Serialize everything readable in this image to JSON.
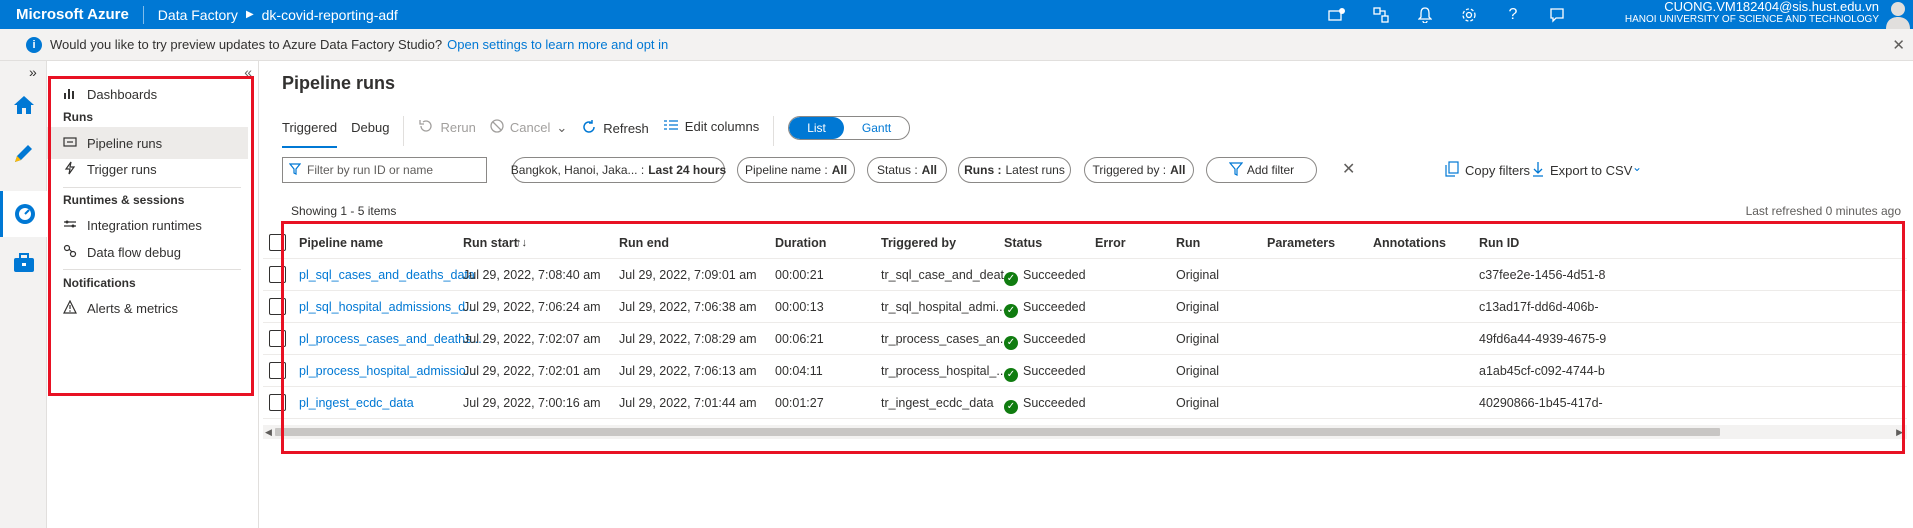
{
  "topbar": {
    "brand": "Microsoft Azure",
    "service": "Data Factory",
    "factory": "dk-covid-reporting-adf",
    "user_email": "CUONG.VM182404@sis.hust.edu.vn",
    "user_org": "HANOI UNIVERSITY OF SCIENCE AND TECHNOLOGY"
  },
  "banner": {
    "message": "Would you like to try preview updates to Azure Data Factory Studio?",
    "link": "Open settings to learn more and opt in"
  },
  "nav": {
    "dashboards": "Dashboards",
    "runs_header": "Runs",
    "pipeline_runs": "Pipeline runs",
    "trigger_runs": "Trigger runs",
    "runtimes_header": "Runtimes & sessions",
    "integration_runtimes": "Integration runtimes",
    "data_flow_debug": "Data flow debug",
    "notifications_header": "Notifications",
    "alerts_metrics": "Alerts & metrics"
  },
  "page": {
    "title": "Pipeline runs",
    "tab_triggered": "Triggered",
    "tab_debug": "Debug",
    "rerun": "Rerun",
    "cancel": "Cancel",
    "refresh": "Refresh",
    "edit_columns": "Edit columns",
    "view_list": "List",
    "view_gantt": "Gantt"
  },
  "filters": {
    "search_placeholder": "Filter by run ID or name",
    "timezone_label": "Bangkok, Hanoi, Jaka... :",
    "timezone_value": "Last 24 hours",
    "pipeline_label": "Pipeline name :",
    "pipeline_value": "All",
    "status_label": "Status :",
    "status_value": "All",
    "runs_label": "Runs :",
    "runs_value": "Latest runs",
    "triggered_label": "Triggered by :",
    "triggered_value": "All",
    "add_filter": "Add filter",
    "copy_filters": "Copy filters",
    "export_csv": "Export to CSV"
  },
  "grid": {
    "showing": "Showing 1 - 5 items",
    "last_refreshed": "Last refreshed 0 minutes ago",
    "columns": {
      "pipeline_name": "Pipeline name",
      "run_start": "Run start",
      "run_end": "Run end",
      "duration": "Duration",
      "triggered_by": "Triggered by",
      "status": "Status",
      "error": "Error",
      "run": "Run",
      "parameters": "Parameters",
      "annotations": "Annotations",
      "run_id": "Run ID"
    },
    "rows": [
      {
        "pipeline_name": "pl_sql_cases_and_deaths_data",
        "run_start": "Jul 29, 2022, 7:08:40 am",
        "run_end": "Jul 29, 2022, 7:09:01 am",
        "duration": "00:00:21",
        "triggered_by": "tr_sql_case_and_deat...",
        "status": "Succeeded",
        "run": "Original",
        "run_id": "c37fee2e-1456-4d51-8"
      },
      {
        "pipeline_name": "pl_sql_hospital_admissions_d...",
        "run_start": "Jul 29, 2022, 7:06:24 am",
        "run_end": "Jul 29, 2022, 7:06:38 am",
        "duration": "00:00:13",
        "triggered_by": "tr_sql_hospital_admi...",
        "status": "Succeeded",
        "run": "Original",
        "run_id": "c13ad17f-dd6d-406b-"
      },
      {
        "pipeline_name": "pl_process_cases_and_deaths...",
        "run_start": "Jul 29, 2022, 7:02:07 am",
        "run_end": "Jul 29, 2022, 7:08:29 am",
        "duration": "00:06:21",
        "triggered_by": "tr_process_cases_an...",
        "status": "Succeeded",
        "run": "Original",
        "run_id": "49fd6a44-4939-4675-9"
      },
      {
        "pipeline_name": "pl_process_hospital_admissio...",
        "run_start": "Jul 29, 2022, 7:02:01 am",
        "run_end": "Jul 29, 2022, 7:06:13 am",
        "duration": "00:04:11",
        "triggered_by": "tr_process_hospital_...",
        "status": "Succeeded",
        "run": "Original",
        "run_id": "a1ab45cf-c092-4744-b"
      },
      {
        "pipeline_name": "pl_ingest_ecdc_data",
        "run_start": "Jul 29, 2022, 7:00:16 am",
        "run_end": "Jul 29, 2022, 7:01:44 am",
        "duration": "00:01:27",
        "triggered_by": "tr_ingest_ecdc_data",
        "status": "Succeeded",
        "run": "Original",
        "run_id": "40290866-1b45-417d-"
      }
    ]
  }
}
